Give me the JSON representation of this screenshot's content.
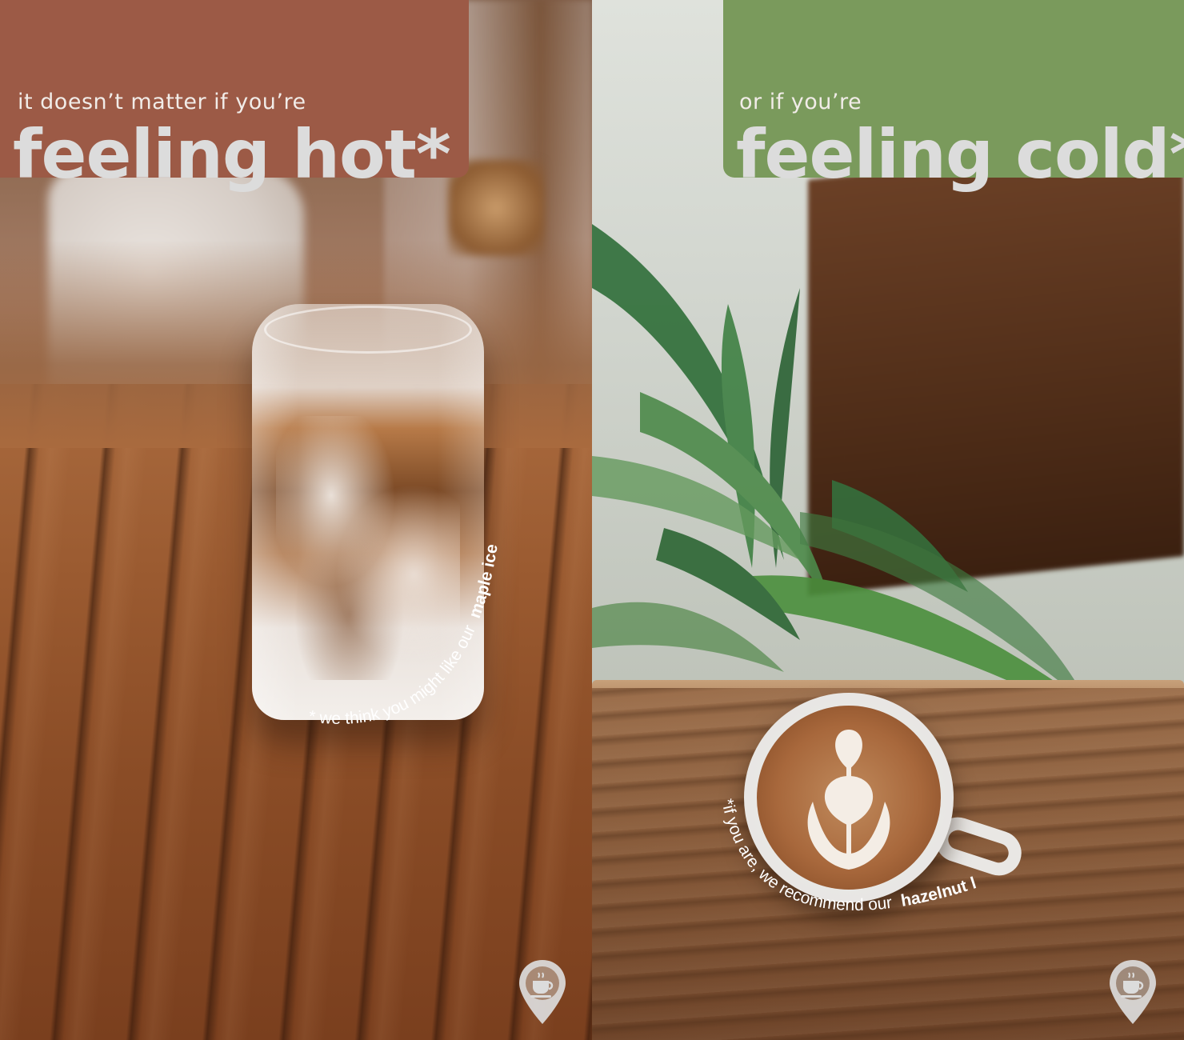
{
  "left_panel": {
    "subheading": "it doesn’t matter if you’re",
    "headline": "feeling hot*",
    "footnote_regular": "* we think you might like our",
    "footnote_bold": "maple iced latte",
    "tab_color": "#9c5a46"
  },
  "right_panel": {
    "subheading": "or if you’re",
    "headline": "feeling cold*",
    "footnote_regular": "*if you are, we recommend our",
    "footnote_bold": "hazelnut latte",
    "tab_color": "#7a9a5c"
  },
  "icons": {
    "location": "coffee-cup-location-pin"
  }
}
